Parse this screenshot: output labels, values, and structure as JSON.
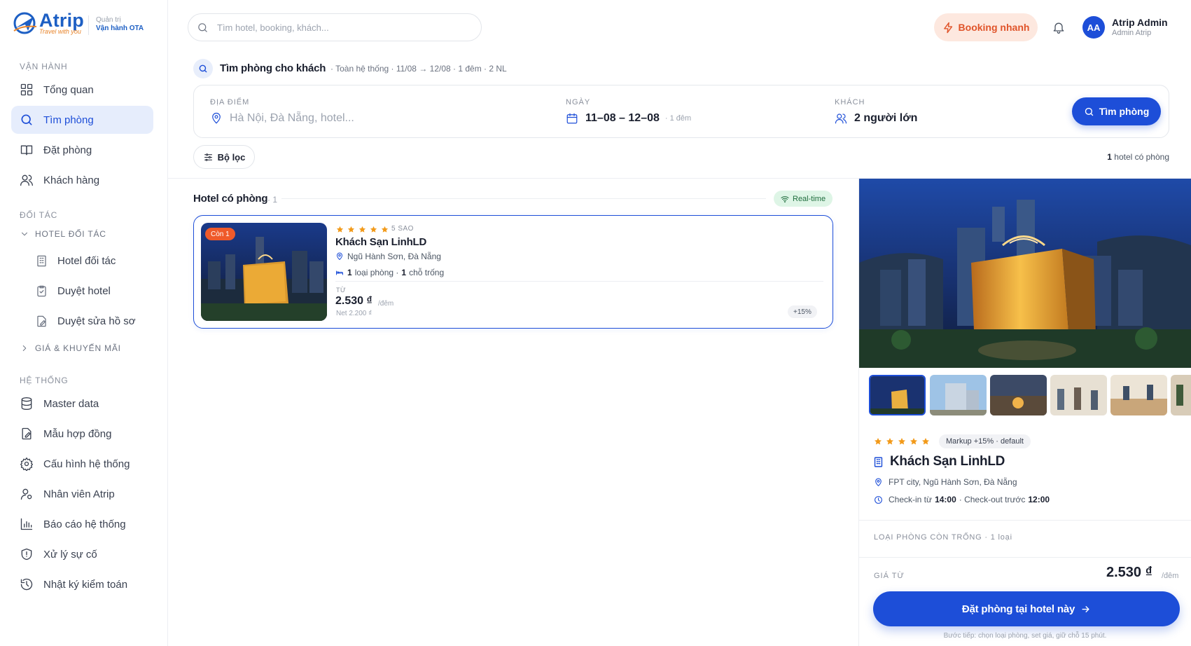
{
  "brand": {
    "name": "Atrip",
    "tagline": "Travel with you",
    "role_top": "Quản trị",
    "role_bottom": "Vận hành OTA"
  },
  "sidebar": {
    "sections": [
      "VẬN HÀNH",
      "ĐỐI TÁC",
      "HỆ THỐNG"
    ],
    "ops": [
      {
        "label": "Tổng quan",
        "icon": "dashboard-icon"
      },
      {
        "label": "Tìm phòng",
        "icon": "search-icon",
        "active": true
      },
      {
        "label": "Đặt phòng",
        "icon": "book-icon"
      },
      {
        "label": "Khách hàng",
        "icon": "users-icon"
      }
    ],
    "partner_group": "HOTEL ĐỐI TÁC",
    "partner_items": [
      {
        "label": "Hotel đối tác",
        "icon": "building-icon"
      },
      {
        "label": "Duyệt hotel",
        "icon": "clipboard-check-icon"
      },
      {
        "label": "Duyệt sửa hồ sơ",
        "icon": "file-edit-icon"
      }
    ],
    "promo_group": "GIÁ & KHUYẾN MÃI",
    "system": [
      {
        "label": "Master data",
        "icon": "database-icon"
      },
      {
        "label": "Mẫu hợp đồng",
        "icon": "contract-icon"
      },
      {
        "label": "Cấu hình hệ thống",
        "icon": "gear-icon"
      },
      {
        "label": "Nhân viên Atrip",
        "icon": "user-staff-icon"
      },
      {
        "label": "Báo cáo hệ thống",
        "icon": "bar-chart-icon"
      },
      {
        "label": "Xử lý sự cố",
        "icon": "shield-icon"
      },
      {
        "label": "Nhật ký kiểm toán",
        "icon": "history-icon"
      }
    ]
  },
  "header": {
    "search_placeholder": "Tìm hotel, booking, khách...",
    "quick_booking": "Booking nhanh",
    "avatar_initials": "AA",
    "user_name": "Atrip Admin",
    "user_role": "Admin Atrip"
  },
  "search": {
    "title": "Tìm phòng cho khách",
    "meta": "· Toàn hệ thống · 11/08 → 12/08 · 1 đêm · 2 NL",
    "location_label": "ĐỊA ĐIỂM",
    "location_placeholder": "Hà Nội, Đà Nẵng, hotel...",
    "date_label": "NGÀY",
    "date_value": "11–08 – 12–08",
    "nights": "· 1 đêm",
    "guest_label": "KHÁCH",
    "guest_value": "2 người lớn",
    "button": "Tìm phòng",
    "filter": "Bộ lọc",
    "count_num": "1",
    "count_text": "hotel có phòng"
  },
  "list": {
    "title": "Hotel có phòng",
    "count": "· 1",
    "realtime": "Real-time",
    "hotel": {
      "badge": "Còn 1",
      "star_count": 5,
      "star_label": "5 SAO",
      "name": "Khách Sạn LinhLD",
      "location": "Ngũ Hành Sơn, Đà Nẵng",
      "rooms_num": "1",
      "rooms_text": "loại phòng ·",
      "free_num": "1",
      "free_text": "chỗ trống",
      "from": "TỪ",
      "price": "2.530 ₫",
      "unit": "/đêm",
      "net": "Net 2.200 ₫",
      "markup": "+15%"
    }
  },
  "detail": {
    "star_count": 5,
    "markup": "Markup +15% · default",
    "name": "Khách Sạn LinhLD",
    "address": "FPT city, Ngũ Hành Sơn, Đà Nẵng",
    "checkin_label": "Check-in từ",
    "checkin": "14:00",
    "checkout_label": "· Check-out trước",
    "checkout": "12:00",
    "room_types": "LOẠI PHÒNG CÒN TRỐNG · 1 loại",
    "from_label": "GIÁ TỪ",
    "price": "2.530 ₫",
    "unit": "/đêm",
    "book_button": "Đặt phòng tại hotel này",
    "note": "Bước tiếp: chọn loại phòng, set giá, giữ chỗ 15 phút."
  },
  "colors": {
    "primary": "#1d4ed8",
    "accent": "#e0542a",
    "star": "#f29a1a",
    "realtime_bg": "#def5e6"
  }
}
